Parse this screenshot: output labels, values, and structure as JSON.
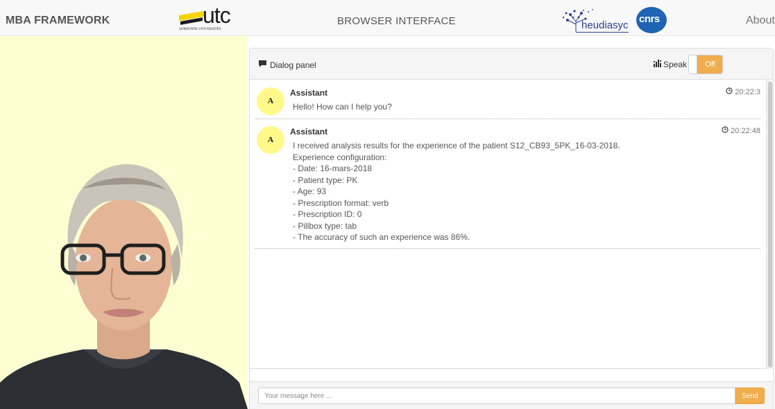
{
  "navbar": {
    "brand": "MBA FRAMEWORK",
    "center_title": "BROWSER INTERFACE",
    "about": "About",
    "logos": {
      "utc_text": "utc",
      "utc_subtitle": "SORBONNE UNIVERSITÉS",
      "heudiasyc_text": "heudiasyc",
      "cnrs_text": "cnrs"
    }
  },
  "colors": {
    "avatar_background": "#fdffd2",
    "accent_orange": "#f0ad4e",
    "assistant_avatar": "#fff98a"
  },
  "dialog_panel": {
    "title": "Dialog panel",
    "title_icon": "comment-icon",
    "speak_label": "Speak",
    "speak_icon": "sound-bars-icon",
    "speak_toggle_state": "Off"
  },
  "messages": [
    {
      "avatar_letter": "A",
      "sender": "Assistant",
      "time": "20:22:3",
      "lines": [
        "Hello! How can I help you?"
      ]
    },
    {
      "avatar_letter": "A",
      "sender": "Assistant",
      "time": "20:22:48",
      "lines": [
        "I received analysis results for the experience of the patient S12_CB93_5PK_16-03-2018.",
        "Experience configuration:",
        "- Date: 16-mars-2018",
        "- Patient type: PK",
        "- Age: 93",
        "- Prescription format: verb",
        "- Prescription ID: 0",
        "- Pillbox type: tab",
        "- The accuracy of such an experience was 86%."
      ]
    }
  ],
  "footer": {
    "input_placeholder": "Your message here ...",
    "input_value": "",
    "send_label": "Send"
  }
}
